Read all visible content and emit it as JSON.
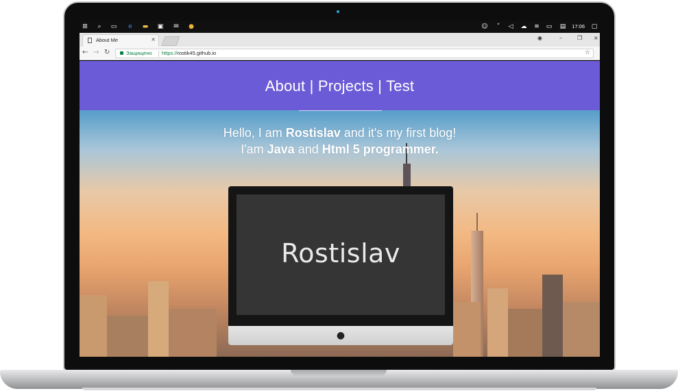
{
  "taskbar": {
    "icons": [
      "windows-start-icon",
      "search-icon",
      "task-view-icon",
      "edge-browser-icon",
      "file-explorer-icon",
      "store-icon",
      "mail-icon",
      "chrome-icon"
    ],
    "tray_icons": [
      "people-icon",
      "chevron-up-icon",
      "volume-icon",
      "onedrive-icon",
      "wifi-icon",
      "keyboard-icon",
      "language-icon",
      "notification-icon"
    ],
    "clock": "17:06"
  },
  "browser": {
    "tab_title": "About Me",
    "tab_close": "×",
    "secure_label": "Защищено",
    "url_scheme": "https://",
    "url_host": "rostik45.github.io"
  },
  "site": {
    "nav": {
      "about": "About",
      "sep1": "|",
      "projects": "Projects",
      "sep2": "|",
      "test": "Test"
    },
    "hero": {
      "line1_pre": "Hello, I am ",
      "line1_bold": "Rostislav",
      "line1_post": " and it's my first blog!",
      "line2_pre": "I'am ",
      "line2_bold1": "Java",
      "line2_mid": " and ",
      "line2_bold2": "Html 5 programmer."
    },
    "monitor_name": "Rostislav"
  },
  "colors": {
    "navbar": "#6c5bd6",
    "taskbar": "#101010",
    "secure_green": "#0b8043"
  }
}
